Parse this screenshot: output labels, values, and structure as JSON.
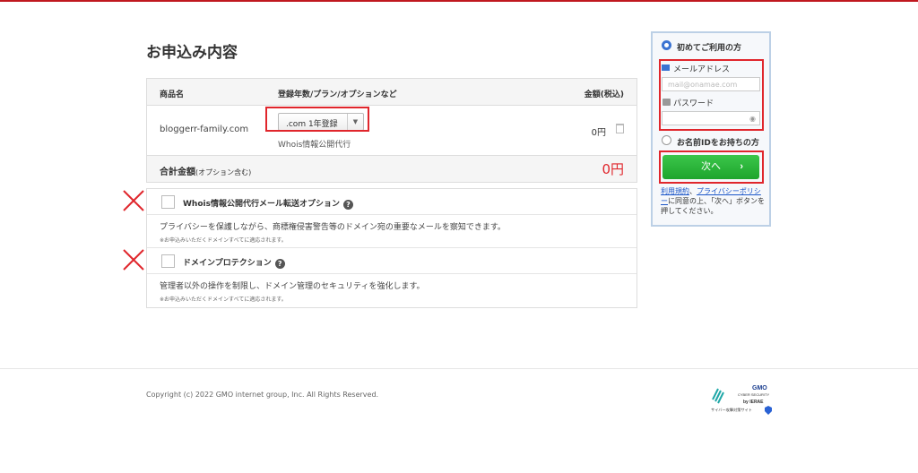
{
  "page": {
    "title": "お申込み内容"
  },
  "order": {
    "headers": {
      "product": "商品名",
      "plan": "登録年数/プラン/オプションなど",
      "price": "金額(税込)"
    },
    "domain": "bloggerr-family.com",
    "plan_selected": ".com 1年登録",
    "whois": "Whois情報公開代行",
    "price": "0円",
    "total_label": "合計金額",
    "total_note": "(オプション含む)",
    "total_value": "0円"
  },
  "options": [
    {
      "title": "Whois情報公開代行メール転送オプション",
      "desc": "プライバシーを保護しながら、商標権侵害警告等のドメイン宛の重要なメールを察知できます。",
      "note": "※お申込みいただくドメインすべてに適応されます。"
    },
    {
      "title": "ドメインプロテクション",
      "desc": "管理者以外の操作を制限し、ドメイン管理のセキュリティを強化します。",
      "note": "※お申込みいただくドメインすべてに適応されます。"
    }
  ],
  "login": {
    "first_time": "初めてご利用の方",
    "email_label": "メールアドレス",
    "email_placeholder": "mail@onamae.com",
    "password_label": "パスワード",
    "has_id": "お名前IDをお持ちの方",
    "next": "次へ",
    "next_arrow": "›",
    "terms_link": "利用規約",
    "privacy_link": "プライバシーポリシー",
    "terms_sep": "、",
    "terms_text": "に同意の上、「次へ」ボタンを押してください。"
  },
  "footer": {
    "copyright": "Copyright (c) 2022 GMO internet group, Inc. All Rights Reserved.",
    "badge_line1": "GMO",
    "badge_line2": "CYBER SECURITY",
    "badge_line3": "by IERAE",
    "badge_line4": "サイバー攻撃対策サイト"
  },
  "colors": {
    "accent_red": "#e0262c",
    "primary_blue": "#3b73d2",
    "button_green": "#22ab31"
  }
}
